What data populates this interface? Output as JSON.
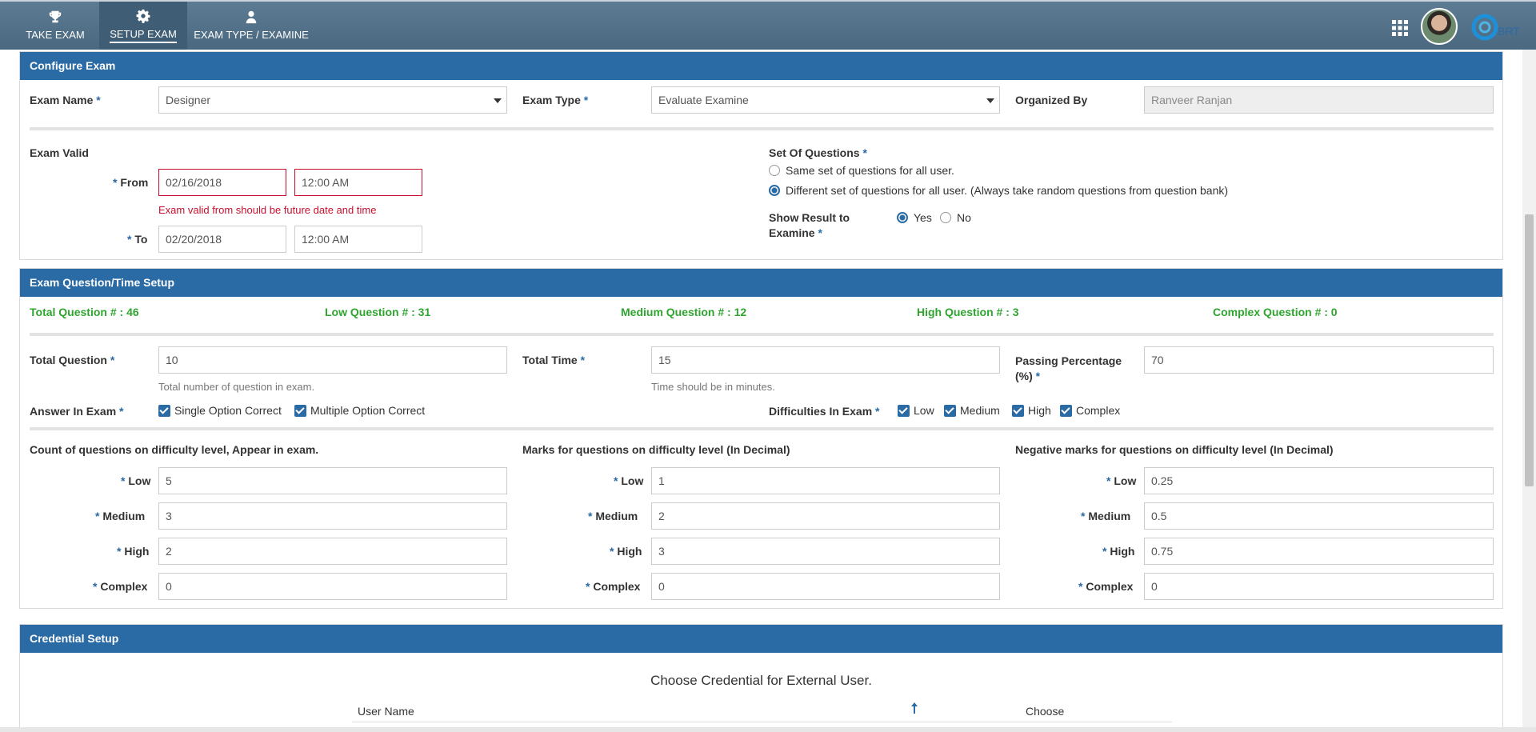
{
  "nav": {
    "tabs": [
      {
        "label": "TAKE EXAM",
        "icon": "trophy-icon"
      },
      {
        "label": "SETUP EXAM",
        "icon": "gear-icon"
      },
      {
        "label": "EXAM TYPE / EXAMINE",
        "icon": "user-icon"
      }
    ],
    "brand": "BRT"
  },
  "configure": {
    "title": "Configure Exam",
    "exam_name_label": "Exam Name",
    "exam_name_value": "Designer",
    "exam_type_label": "Exam Type",
    "exam_type_value": "Evaluate Examine",
    "organized_by_label": "Organized By",
    "organized_by_value": "Ranveer Ranjan",
    "exam_valid_label": "Exam Valid",
    "from_label": "From",
    "from_date": "02/16/2018",
    "from_time": "12:00 AM",
    "from_error": "Exam valid from should be future date and time",
    "to_label": "To",
    "to_date": "02/20/2018",
    "to_time": "12:00 AM",
    "set_questions_label": "Set Of Questions",
    "set_option_same": "Same set of questions for all user.",
    "set_option_different": "Different set of questions for all user. (Always take random questions from question bank)",
    "show_result_label_1": "Show Result to",
    "show_result_label_2": "Examine",
    "yes_label": "Yes",
    "no_label": "No"
  },
  "question_setup": {
    "title": "Exam Question/Time Setup",
    "stats": [
      "Total Question #  : 46",
      "Low Question #  : 31",
      "Medium Question #  : 12",
      "High Question #  : 3",
      "Complex Question #  : 0"
    ],
    "total_question_label": "Total Question",
    "total_question_value": "10",
    "total_question_hint": "Total number of question in exam.",
    "total_time_label": "Total Time",
    "total_time_value": "15",
    "total_time_hint": "Time should be in minutes.",
    "passing_label_1": "Passing Percentage",
    "passing_label_2": "(%)",
    "passing_value": "70",
    "answer_label": "Answer In Exam",
    "answer_options": [
      "Single Option Correct",
      "Multiple Option Correct"
    ],
    "difficulties_label": "Difficulties In Exam",
    "difficulty_options": [
      "Low",
      "Medium",
      "High",
      "Complex"
    ],
    "count_heading": "Count of questions on difficulty level, Appear in exam.",
    "marks_heading": "Marks for questions on difficulty level (In Decimal)",
    "negative_heading": "Negative marks for questions on difficulty level (In Decimal)",
    "level_labels": [
      "Low",
      "Medium",
      "High",
      "Complex"
    ],
    "count_values": [
      "5",
      "3",
      "2",
      "0"
    ],
    "marks_values": [
      "1",
      "2",
      "3",
      "0"
    ],
    "negative_values": [
      "0.25",
      "0.5",
      "0.75",
      "0"
    ]
  },
  "credential": {
    "title": "Credential Setup",
    "subtitle": "Choose Credential for External User.",
    "col_user": "User Name",
    "col_choose": "Choose"
  }
}
